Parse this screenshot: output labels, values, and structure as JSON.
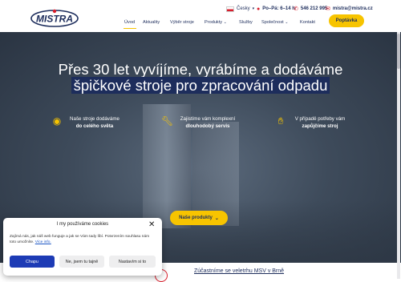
{
  "header": {
    "logo_text": "MISTRA",
    "language": "Česky",
    "hours_label": "Po–Pá: 6–14 h",
    "phone": "546 212 995",
    "email": "mistra@mistra.cz",
    "poptavka_label": "Poptávka",
    "nav": [
      "Úvod",
      "Aktuality",
      "Výběr stroje",
      "Produkty",
      "Služby",
      "Společnost",
      "Kontakt"
    ]
  },
  "hero": {
    "line1": "Přes 30 let vyvíjíme, vyrábíme a dodáváme",
    "line2": "špičkové stroje pro zpracování odpadu",
    "features": [
      {
        "top": "Naše stroje dodáváme",
        "bottom": "do celého světa",
        "icon": "globe-icon"
      },
      {
        "top": "Zajistíme vám komplexní",
        "bottom": "dlouhodobý servis",
        "icon": "wrench-icon"
      },
      {
        "top": "V případě potřeby vám",
        "bottom": "zapůjčíme stroj",
        "icon": "handshake-icon"
      }
    ],
    "cta_label": "Naše produkty"
  },
  "news": {
    "link_text": "Zúčastníme se veletrhu MSV v Brně"
  },
  "cookie": {
    "title": "I my používáme cookies",
    "text": "Zajímá nás, jak náš web funguje a jak se Vám tady líbí. Potvrzením souhlasu nám toto umožníte.",
    "link": "Více info.",
    "btn_accept": "Chapu",
    "btn_necessary": "Ne, jsem tu tajně",
    "btn_settings": "Nastavím si to"
  },
  "colors": {
    "brand_navy": "#1d2d5c",
    "accent_yellow": "#f7c400",
    "accent_red": "#d81e2c"
  }
}
